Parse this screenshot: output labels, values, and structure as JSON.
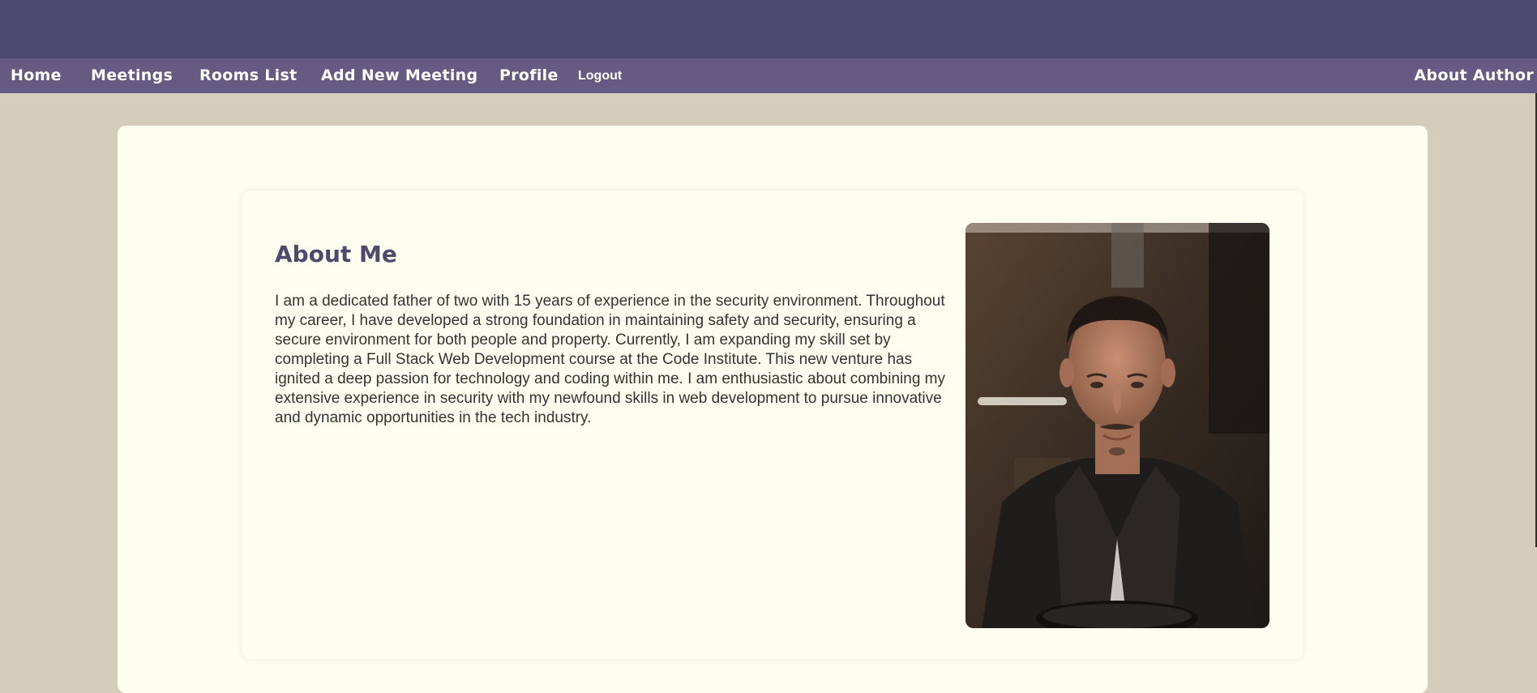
{
  "nav": {
    "home": "Home",
    "meetings": "Meetings",
    "rooms_list": "Rooms List",
    "add_new_meeting": "Add New Meeting",
    "profile": "Profile",
    "logout": "Logout",
    "about_author": "About Author"
  },
  "about": {
    "title": "About Me",
    "text": "I am a dedicated father of two with 15 years of experience in the security environment. Throughout my career, I have developed a strong foundation in maintaining safety and security, ensuring a secure environment for both people and property. Currently, I am expanding my skill set by completing a Full Stack Web Development course at the Code Institute. This new venture has ignited a deep passion for technology and coding within me. I am enthusiastic about combining my extensive experience in security with my newfound skills in web development to pursue innovative and dynamic opportunities in the tech industry.",
    "photo": "author-portrait"
  },
  "colors": {
    "banner": "#4e4a6d",
    "navbar": "#645a82",
    "page_background": "#d4cdbb",
    "card_background": "#fefef0",
    "title": "#4e4a6d"
  }
}
